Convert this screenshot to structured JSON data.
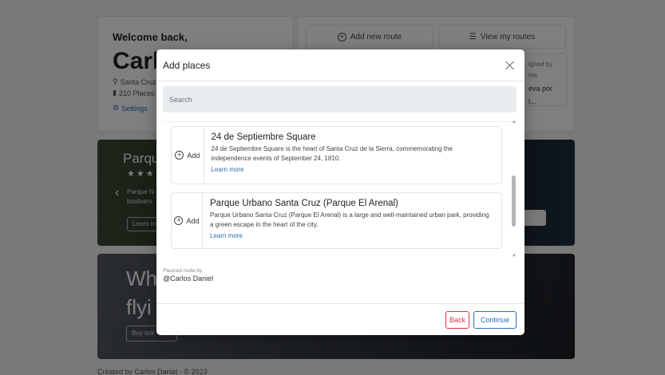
{
  "background": {
    "welcome": {
      "title": "Welcome back,",
      "name": "Carlo",
      "location": "Santa Cruz",
      "places": "210 Places",
      "settings": "Settings"
    },
    "actions": {
      "add_route": "Add new route",
      "view_routes": "View my routes",
      "assigned_label": "igned by me",
      "assigned_value": "eva por l..."
    },
    "park": {
      "title": "Parqu",
      "stars": "★★★",
      "desc_line1": "Parque N",
      "desc_line2": "biodivers",
      "learn": "Learn m"
    },
    "promo": {
      "line1": "Wh",
      "line2": "flyi",
      "button": "Buy tick"
    },
    "footer": "Created by Carlos Daniel - © 2023"
  },
  "modal": {
    "title": "Add places",
    "search_placeholder": "Search",
    "add_label": "Add",
    "places": [
      {
        "name": "24 de Septiembre Square",
        "description": "24 de Septiembre Square is the heart of Santa Cruz de la Sierra, commemorating the independence events of September 24, 1810.",
        "link": "Learn more"
      },
      {
        "name": "Parque Urbano Santa Cruz (Parque El Arenal)",
        "description": "Parque Urbano Santa Cruz (Parque El Arenal) is a large and well-maintained urban park, providing a green escape in the heart of the city.",
        "link": "Learn more"
      }
    ],
    "planned_label": "Planned route by",
    "planned_user": "@Carlos Daniel",
    "back": "Back",
    "continue": "Continue"
  }
}
